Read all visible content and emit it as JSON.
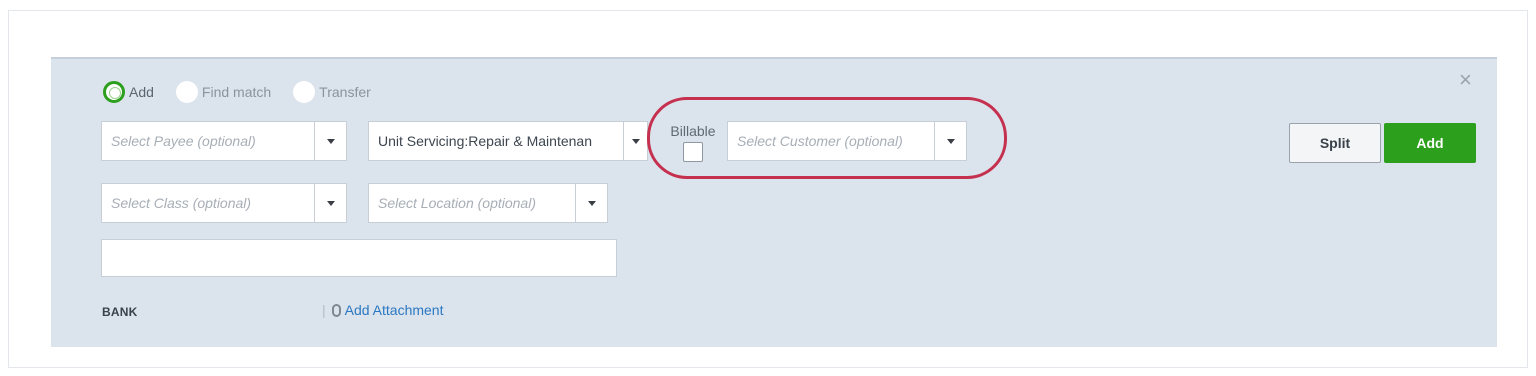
{
  "radio_options": {
    "add": "Add",
    "find_match": "Find match",
    "transfer": "Transfer",
    "selected": "Add"
  },
  "fields": {
    "payee_placeholder": "Select Payee (optional)",
    "account_value": "Unit Servicing:Repair & Maintenan",
    "billable_label": "Billable",
    "customer_placeholder": "Select Customer (optional)",
    "class_placeholder": "Select Class (optional)",
    "location_placeholder": "Select Location (optional)",
    "memo_value": ""
  },
  "footer": {
    "bank_label": "BANK",
    "separator": "|",
    "attachment_label": "Add Attachment"
  },
  "buttons": {
    "split": "Split",
    "add": "Add",
    "close_glyph": "×"
  },
  "colors": {
    "accent_green": "#2ca01c",
    "highlight_red": "#c5304f",
    "link_blue": "#2b78c2"
  },
  "icons": {
    "close": "close-icon",
    "attachment": "paperclip-icon",
    "dropdown": "chevron-down-icon"
  }
}
